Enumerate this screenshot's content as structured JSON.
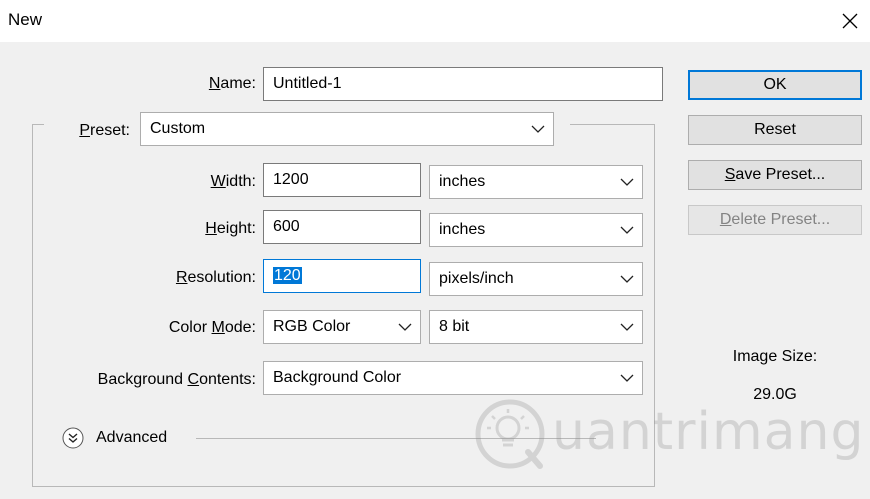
{
  "window": {
    "title": "New"
  },
  "name": {
    "label": "Name:",
    "mnemonic": "N",
    "rest": "ame:",
    "value": "Untitled-1"
  },
  "preset": {
    "mnemonic": "P",
    "rest": "reset:",
    "value": "Custom"
  },
  "width": {
    "mnemonic": "W",
    "rest": "idth:",
    "value": "1200",
    "unit": "inches"
  },
  "height": {
    "mnemonic": "H",
    "rest": "eight:",
    "value": "600",
    "unit": "inches"
  },
  "resolution": {
    "mnemonic": "R",
    "rest": "esolution:",
    "value": "120",
    "unit": "pixels/inch"
  },
  "color_mode": {
    "prefix": "Color ",
    "mnemonic": "M",
    "rest": "ode:",
    "value": "RGB Color",
    "depth": "8 bit"
  },
  "background": {
    "prefix": "Background ",
    "mnemonic": "C",
    "rest": "ontents:",
    "value": "Background Color"
  },
  "advanced": {
    "label": "Advanced"
  },
  "buttons": {
    "ok": "OK",
    "reset": "Reset",
    "save_mnemonic": "S",
    "save_rest": "ave Preset...",
    "delete_mnemonic": "D",
    "delete_rest": "elete Preset..."
  },
  "image_size": {
    "label": "Image Size:",
    "value": "29.0G"
  },
  "watermark": {
    "text": "uantrimang"
  },
  "icons": {
    "close": "close-icon",
    "chevron": "chevron-down-icon",
    "advanced_toggle": "double-chevron-down-icon",
    "watermark_logo": "lightbulb-logo-icon"
  },
  "colors": {
    "accent": "#0078d7",
    "dialog_bg": "#f0f0f0",
    "disabled_text": "#838383"
  }
}
